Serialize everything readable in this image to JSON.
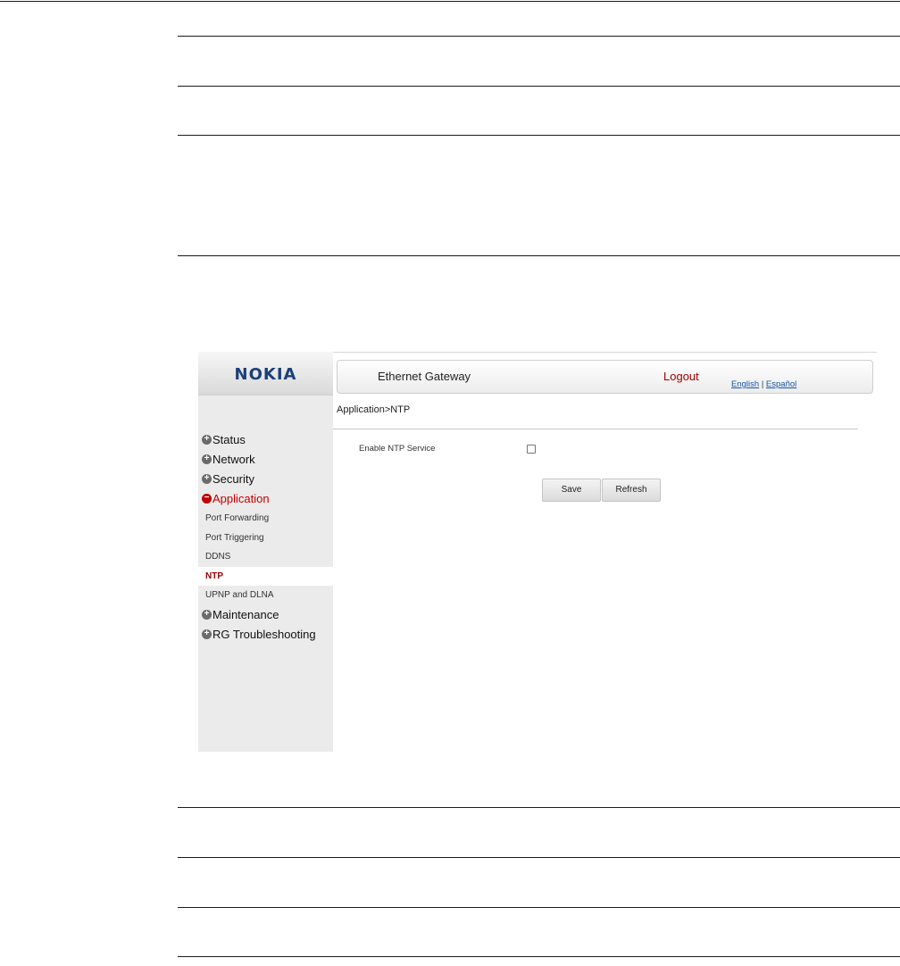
{
  "doc": {
    "rule_count": 10
  },
  "sidebar": {
    "logo": "NOKIA",
    "menu": [
      {
        "label": "Status",
        "icon": "plus-circle-icon"
      },
      {
        "label": "Network",
        "icon": "plus-circle-icon"
      },
      {
        "label": "Security",
        "icon": "plus-circle-icon"
      },
      {
        "label": "Application",
        "icon": "minus-circle-icon",
        "expanded": true
      },
      {
        "label": "Maintenance",
        "icon": "plus-circle-icon"
      },
      {
        "label": "RG Troubleshooting",
        "icon": "plus-circle-icon"
      }
    ],
    "submenu": [
      "Port Forwarding",
      "Port Triggering",
      "DDNS",
      "NTP",
      "UPNP and DLNA"
    ],
    "selected": "NTP"
  },
  "header": {
    "title": "Ethernet Gateway",
    "logout": "Logout",
    "lang_english": "English",
    "lang_separator": "|",
    "lang_spanish": "Español"
  },
  "main": {
    "breadcrumb": "Application>NTP",
    "enable_label": "Enable NTP Service",
    "enable_checked": false,
    "save_label": "Save",
    "refresh_label": "Refresh"
  },
  "colors": {
    "active_menu": "#c00000",
    "link": "#1a55a8",
    "logo": "#1c3f7a"
  }
}
